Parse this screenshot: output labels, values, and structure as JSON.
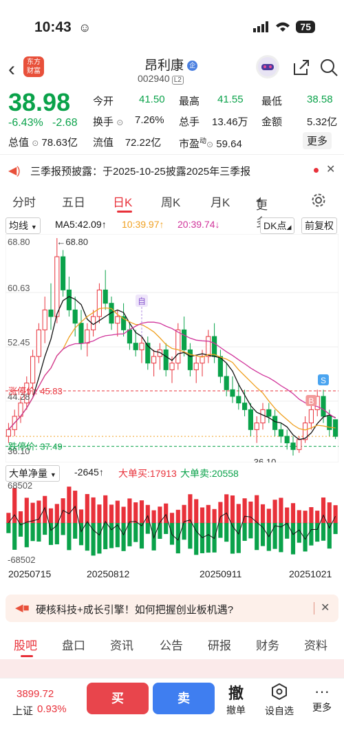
{
  "status_bar": {
    "time": "10:43",
    "battery": "75"
  },
  "header": {
    "title": "昂利康",
    "code": "002940",
    "level": "L2",
    "logo_lines": [
      "东方",
      "财富"
    ],
    "badge": "企"
  },
  "quote": {
    "price": "38.98",
    "change_pct": "-6.43%",
    "change": "-2.68",
    "open_label": "今开",
    "open": "41.50",
    "high_label": "最高",
    "high": "41.55",
    "low_label": "最低",
    "low": "38.58",
    "turnover_label": "换手",
    "turnover": "7.26%",
    "volume_label": "总手",
    "volume": "13.46万",
    "amount_label": "金额",
    "amount": "5.32亿",
    "mktcap_label": "总值",
    "mktcap": "78.63亿",
    "float_label": "流值",
    "float": "72.22亿",
    "pe_label": "市盈",
    "pe_sup": "动",
    "pe": "59.64",
    "more_label": "更多"
  },
  "notice": {
    "text": "三季报预披露：于2025-10-25披露2025年三季报"
  },
  "tabs": [
    "分时",
    "五日",
    "日K",
    "周K",
    "月K",
    "更多"
  ],
  "active_tab": "日K",
  "chart_controls": {
    "indicator": "均线",
    "ma5": "MA5:42.09",
    "ma10": "10:39.97",
    "ma20": "20:39.74",
    "dk": "DK点",
    "adjust": "前复权"
  },
  "price_chart": {
    "y_labels": [
      "68.80",
      "60.63",
      "52.45",
      "44.28",
      "36.10"
    ],
    "max_label": "68.80",
    "min_label": "36.10",
    "limit_up_label": "涨停价: 45.83",
    "limit_down_label": "跌停价: 37.49",
    "marker_zi": "自",
    "marker_b": "B",
    "marker_s": "S"
  },
  "volume_chart": {
    "indicator": "大单净量",
    "value": "-2645",
    "big_buy": "大单买:17913",
    "big_sell": "大单卖:20558",
    "y_max": "68502",
    "y_min": "-68502",
    "dates": [
      "20250715",
      "20250812",
      "20250911",
      "20251021"
    ]
  },
  "banner": {
    "text": "硬核科技+成长引擎！如何把握创业板机遇?"
  },
  "bottom_tabs": [
    "股吧",
    "盘口",
    "资讯",
    "公告",
    "研报",
    "财务",
    "资料"
  ],
  "bottom_bar": {
    "index_value": "3899.72",
    "index_name": "上证",
    "index_pct": "0.93%",
    "buy": "买",
    "sell": "卖",
    "cancel": "撤",
    "cancel_label": "撤单",
    "watch_label": "设自选",
    "more_label": "更多"
  },
  "colors": {
    "up": "#e8313a",
    "down": "#0aa24a",
    "ma5": "#111111",
    "ma10": "#f0a020",
    "ma20": "#d0339a"
  },
  "chart_data": {
    "type": "candlestick",
    "x_start": "20250715",
    "x_end": "20251021",
    "ylim": [
      36.1,
      68.8
    ],
    "candles": [
      [
        39,
        41,
        38,
        40
      ],
      [
        40,
        43,
        39,
        42
      ],
      [
        42,
        45,
        41,
        44
      ],
      [
        44,
        48,
        43,
        47
      ],
      [
        47,
        52,
        46,
        51
      ],
      [
        51,
        56,
        50,
        55
      ],
      [
        55,
        60,
        53,
        58
      ],
      [
        58,
        62,
        55,
        57
      ],
      [
        57,
        68.8,
        56,
        66
      ],
      [
        66,
        67,
        60,
        61
      ],
      [
        61,
        63,
        57,
        58
      ],
      [
        58,
        60,
        54,
        56
      ],
      [
        56,
        58,
        52,
        53
      ],
      [
        53,
        56,
        51,
        55
      ],
      [
        55,
        58,
        54,
        57
      ],
      [
        57,
        62,
        56,
        61
      ],
      [
        61,
        64,
        58,
        59
      ],
      [
        59,
        60,
        55,
        56
      ],
      [
        56,
        58,
        54,
        57
      ],
      [
        57,
        59,
        54,
        55
      ],
      [
        55,
        56,
        52,
        53
      ],
      [
        53,
        55,
        51,
        52
      ],
      [
        52,
        54,
        50,
        53
      ],
      [
        53,
        54,
        49,
        50
      ],
      [
        50,
        52,
        48,
        51
      ],
      [
        51,
        53,
        49,
        52
      ],
      [
        52,
        53,
        48,
        49
      ],
      [
        49,
        51,
        47,
        50
      ],
      [
        50,
        56,
        49,
        55
      ],
      [
        55,
        57,
        51,
        52
      ],
      [
        52,
        53,
        48,
        49
      ],
      [
        49,
        51,
        47,
        50
      ],
      [
        50,
        52,
        48,
        51
      ],
      [
        51,
        55,
        50,
        54
      ],
      [
        54,
        56,
        50,
        51
      ],
      [
        51,
        52,
        47,
        48
      ],
      [
        48,
        50,
        45,
        46
      ],
      [
        46,
        48,
        44,
        45
      ],
      [
        45,
        47,
        43,
        44
      ],
      [
        44,
        46,
        42,
        43
      ],
      [
        43,
        44,
        39,
        40
      ],
      [
        40,
        42,
        38,
        41
      ],
      [
        41,
        44,
        40,
        43
      ],
      [
        43,
        44,
        41,
        42
      ],
      [
        42,
        43,
        39,
        40
      ],
      [
        40,
        41,
        38,
        39
      ],
      [
        39,
        40,
        37,
        38
      ],
      [
        38,
        39,
        36.1,
        37
      ],
      [
        37,
        39,
        36.5,
        38.5
      ],
      [
        38.5,
        42,
        38,
        41
      ],
      [
        41,
        44,
        40,
        43
      ],
      [
        43,
        46,
        42,
        45
      ],
      [
        45,
        46,
        41,
        42
      ],
      [
        42,
        43,
        39,
        40
      ],
      [
        41.5,
        41.55,
        38.58,
        38.98
      ]
    ]
  }
}
